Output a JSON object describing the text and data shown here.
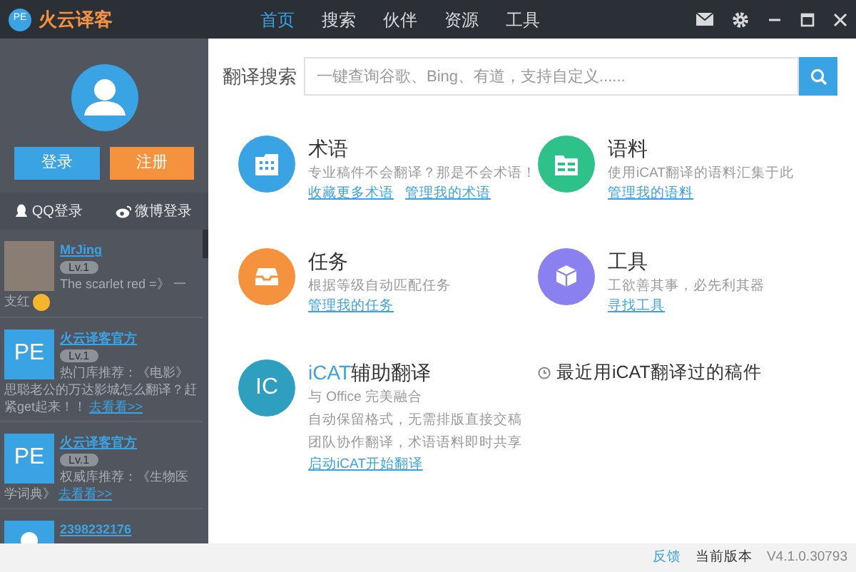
{
  "app": {
    "logo_mark": "PE",
    "logo_text": "火云译客"
  },
  "nav": [
    {
      "label": "首页",
      "selected": true
    },
    {
      "label": "搜索",
      "selected": false
    },
    {
      "label": "伙伴",
      "selected": false
    },
    {
      "label": "资源",
      "selected": false
    },
    {
      "label": "工具",
      "selected": false
    }
  ],
  "sidebar": {
    "buttons": [
      {
        "label": "登录",
        "kind": "primary"
      },
      {
        "label": "注册",
        "kind": "accent"
      }
    ],
    "social": [
      {
        "label": "QQ登录",
        "kind": "qq"
      },
      {
        "label": "微博登录",
        "kind": "weibo"
      }
    ],
    "feed": [
      {
        "kind": "photo",
        "name": "MrJing",
        "level": "Lv.1",
        "text": "The scarlet red =》 一支红",
        "emoji": true
      },
      {
        "kind": "logo",
        "avatar_text": "PE",
        "name": "火云译客官方",
        "level": "Lv.1",
        "text": "热门库推荐：《电影》思聪老公的万达影城怎么翻译？赶紧get起来！！",
        "link": "去看看>>"
      },
      {
        "kind": "logo",
        "avatar_text": "PE",
        "name": "火云译客官方",
        "level": "Lv.1",
        "text": "权威库推荐：《生物医学词典》",
        "link": "去看看>>"
      },
      {
        "kind": "user",
        "name": "2398232176"
      }
    ]
  },
  "main": {
    "search": {
      "label": "翻译搜索",
      "placeholder": "一键查询谷歌、Bing、有道，支持自定义......"
    },
    "features": [
      {
        "kind": "term",
        "color": "#3aa3e3",
        "title": "术语",
        "desc": "专业稿件不会翻译？那是不会术语！",
        "links": [
          "收藏更多术语",
          "管理我的术语"
        ]
      },
      {
        "kind": "corpus",
        "color": "#2ec28a",
        "title": "语料",
        "desc": "使用iCAT翻译的语料汇集于此",
        "links": [
          "管理我的语料"
        ]
      },
      {
        "kind": "task",
        "color": "#f5923e",
        "title": "任务",
        "desc": "根据等级自动匹配任务",
        "links": [
          "管理我的任务"
        ]
      },
      {
        "kind": "tool",
        "color": "#8b80f0",
        "title": "工具",
        "desc": "工欲善其事，必先利其器",
        "links": [
          "寻找工具"
        ]
      }
    ],
    "icat": {
      "icon_text": "IC",
      "title_accent": "iCAT",
      "title": "辅助翻译",
      "lines": [
        "与 Office 完美融合",
        "自动保留格式，无需排版直接交稿",
        "团队协作翻译，术语语料即时共享"
      ],
      "link": "启动iCAT开始翻译"
    },
    "recent": {
      "title": "最近用iCAT翻译过的稿件"
    }
  },
  "status_bar": {
    "feedback": "反馈",
    "version_label": "当前版本",
    "version": "V4.1.0.30793"
  }
}
